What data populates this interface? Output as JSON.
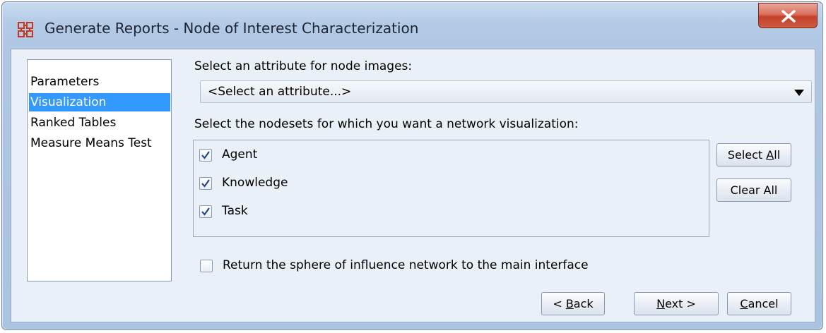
{
  "window": {
    "title": "Generate Reports - Node of Interest Characterization"
  },
  "nav": {
    "items": [
      {
        "label": "Parameters",
        "selected": false
      },
      {
        "label": "Visualization",
        "selected": true
      },
      {
        "label": "Ranked Tables",
        "selected": false
      },
      {
        "label": "Measure Means Test",
        "selected": false
      }
    ]
  },
  "attribute": {
    "label": "Select an attribute for node images:",
    "value": "<Select an attribute...>"
  },
  "nodesets": {
    "label": "Select the nodesets for which you want a network visualization:",
    "items": [
      {
        "label": "Agent",
        "checked": true
      },
      {
        "label": "Knowledge",
        "checked": true
      },
      {
        "label": "Task",
        "checked": true
      }
    ],
    "select_all": {
      "pre": "Select ",
      "u": "A",
      "post": "ll"
    },
    "clear_all": "Clear All"
  },
  "sphere": {
    "label": "Return the sphere of influence network to the main interface",
    "checked": false
  },
  "footer": {
    "back": {
      "pre": "< ",
      "u": "B",
      "post": "ack"
    },
    "next": {
      "pre": "",
      "u": "N",
      "post": "ext >"
    },
    "cancel": {
      "pre": "",
      "u": "C",
      "post": "ancel"
    }
  }
}
